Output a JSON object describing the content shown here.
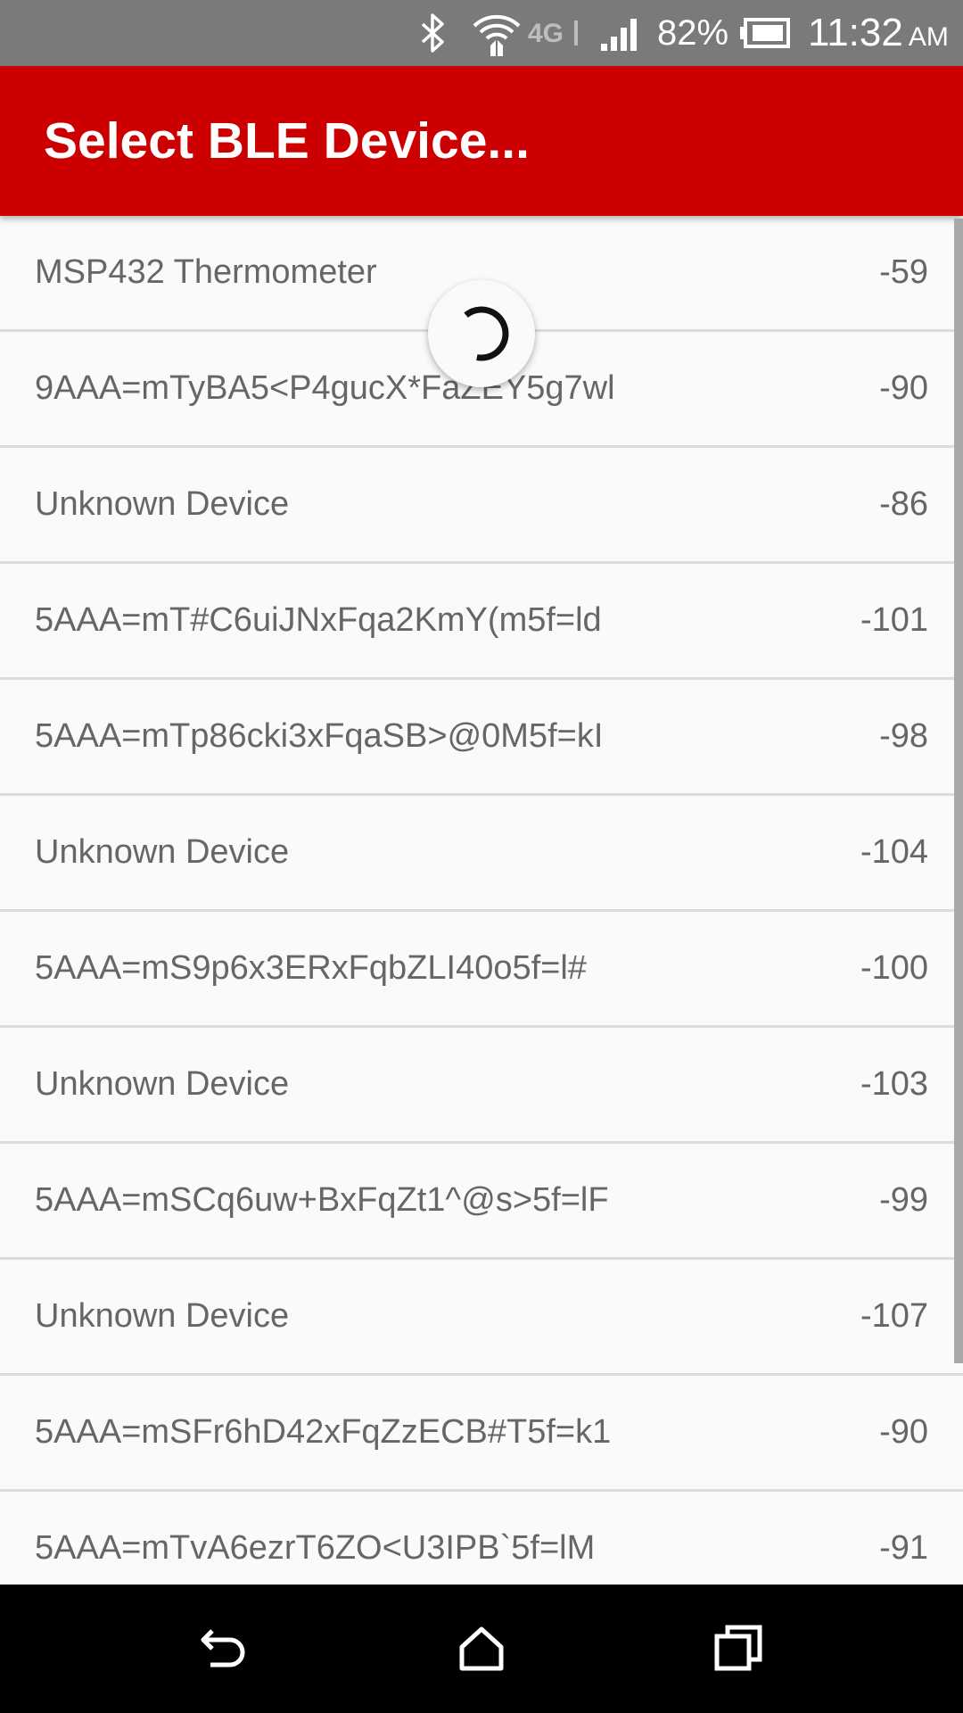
{
  "status_bar": {
    "battery_percent": "82%",
    "time": "11:32",
    "ampm": "AM",
    "network_label": "4G",
    "icons": [
      "bluetooth-icon",
      "wifi-icon",
      "lte-icon",
      "signal-icon",
      "battery-icon"
    ]
  },
  "app_bar": {
    "title": "Select BLE Device...",
    "color": "#cc0000"
  },
  "devices": [
    {
      "name": "MSP432 Thermometer",
      "rssi": "-59"
    },
    {
      "name": "9AAA=mTyBA5<P4gucX*FaZEY5g7wl",
      "rssi": "-90"
    },
    {
      "name": "Unknown Device",
      "rssi": "-86"
    },
    {
      "name": "5AAA=mT#C6uiJNxFqa2KmY(m5f=ld",
      "rssi": "-101"
    },
    {
      "name": "5AAA=mTp86cki3xFqaSB>@0M5f=kI",
      "rssi": "-98"
    },
    {
      "name": "Unknown Device",
      "rssi": "-104"
    },
    {
      "name": "5AAA=mS9p6x3ERxFqbZLI40o5f=l#",
      "rssi": "-100"
    },
    {
      "name": "Unknown Device",
      "rssi": "-103"
    },
    {
      "name": "5AAA=mSCq6uw+BxFqZt1^@s>5f=lF",
      "rssi": "-99"
    },
    {
      "name": "Unknown Device",
      "rssi": "-107"
    },
    {
      "name": "5AAA=mSFr6hD42xFqZzECB#T5f=k1",
      "rssi": "-90"
    },
    {
      "name": "5AAA=mTvA6ezrT6ZO<U3IPB`5f=lM",
      "rssi": "-91"
    }
  ],
  "nav_bar": {
    "icons": [
      "back-icon",
      "home-icon",
      "recents-icon"
    ]
  }
}
